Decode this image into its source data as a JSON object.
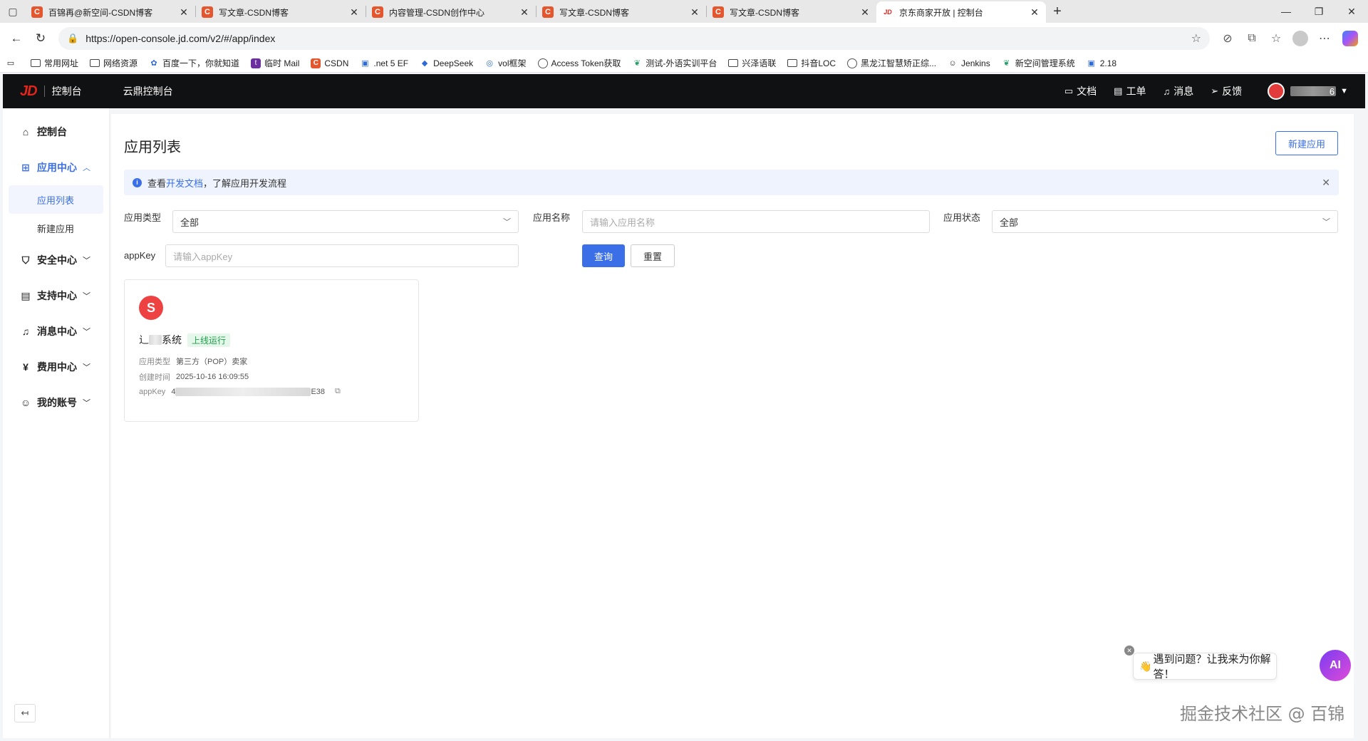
{
  "browser": {
    "tabs": [
      {
        "title": "百锦再@新空间-CSDN博客",
        "favicon": "C",
        "active": false
      },
      {
        "title": "写文章-CSDN博客",
        "favicon": "C",
        "active": false
      },
      {
        "title": "内容管理-CSDN创作中心",
        "favicon": "C",
        "active": false
      },
      {
        "title": "写文章-CSDN博客",
        "favicon": "C",
        "active": false
      },
      {
        "title": "写文章-CSDN博客",
        "favicon": "C",
        "active": false
      },
      {
        "title": "京东商家开放 | 控制台",
        "favicon": "JD",
        "active": true
      }
    ],
    "url": "https://open-console.jd.com/v2/#/app/index",
    "bookmarks": [
      {
        "label": "常用网址",
        "icon": "folder"
      },
      {
        "label": "网络资源",
        "icon": "folder"
      },
      {
        "label": "百度一下，你就知道",
        "icon": "baidu"
      },
      {
        "label": "临时 Mail",
        "icon": "t"
      },
      {
        "label": "CSDN",
        "icon": "C"
      },
      {
        "label": ".net 5 EF",
        "icon": "bili"
      },
      {
        "label": "DeepSeek",
        "icon": "deepseek"
      },
      {
        "label": "vol框架",
        "icon": "vol"
      },
      {
        "label": "Access Token获取",
        "icon": "globe"
      },
      {
        "label": "测试-外语实训平台",
        "icon": "leaf"
      },
      {
        "label": "兴泽语联",
        "icon": "folder"
      },
      {
        "label": "抖音LOC",
        "icon": "folder"
      },
      {
        "label": "黑龙江智慧矫正综...",
        "icon": "globe"
      },
      {
        "label": "Jenkins",
        "icon": "jenkins"
      },
      {
        "label": "新空间管理系统",
        "icon": "leaf"
      },
      {
        "label": "2.18",
        "icon": "bili"
      }
    ]
  },
  "header": {
    "logo": "JD",
    "console": "控制台",
    "yunding": "云鼎控制台",
    "links": [
      {
        "label": "文档",
        "icon": "folder-icon"
      },
      {
        "label": "工单",
        "icon": "document-icon"
      },
      {
        "label": "消息",
        "icon": "bell-icon"
      },
      {
        "label": "反馈",
        "icon": "send-icon"
      }
    ],
    "username_suffix": "6"
  },
  "sidebar": {
    "items": [
      {
        "label": "控制台",
        "icon": "home-icon"
      },
      {
        "label": "应用中心",
        "icon": "grid-icon"
      },
      {
        "label": "安全中心",
        "icon": "shield-icon"
      },
      {
        "label": "支持中心",
        "icon": "document-icon"
      },
      {
        "label": "消息中心",
        "icon": "bell-icon"
      },
      {
        "label": "费用中心",
        "icon": "yen-icon"
      },
      {
        "label": "我的账号",
        "icon": "user-icon"
      }
    ],
    "sub_items": [
      {
        "label": "应用列表",
        "active": true
      },
      {
        "label": "新建应用",
        "active": false
      }
    ]
  },
  "main": {
    "title": "应用列表",
    "new_app_button": "新建应用",
    "notice": {
      "prefix": "查看",
      "link": "开发文档",
      "suffix": "，了解应用开发流程"
    },
    "filters": {
      "type_label": "应用类型",
      "type_value": "全部",
      "name_label": "应用名称",
      "name_placeholder": "请输入应用名称",
      "status_label": "应用状态",
      "status_value": "全部",
      "appkey_label": "appKey",
      "appkey_placeholder": "请输入appKey",
      "query_button": "查询",
      "reset_button": "重置"
    },
    "app_card": {
      "name_start": "辶",
      "name_end": "系统",
      "status": "上线运行",
      "type_label": "应用类型",
      "type_value": "第三方（POP）卖家",
      "created_label": "创建时间",
      "created_value": "2025-10-16 16:09:55",
      "appkey_label": "appKey",
      "appkey_start": "4",
      "appkey_end": "E38"
    }
  },
  "assistant": {
    "bubble_text": "遇到问题？让我来为你解答！",
    "button_label": "AI"
  },
  "watermark": "掘金技术社区 @ 百锦",
  "colors": {
    "accent": "#3a6fe8",
    "header_bg": "#101112",
    "jd_red": "#e1251b",
    "status_green": "#1e9e48"
  }
}
